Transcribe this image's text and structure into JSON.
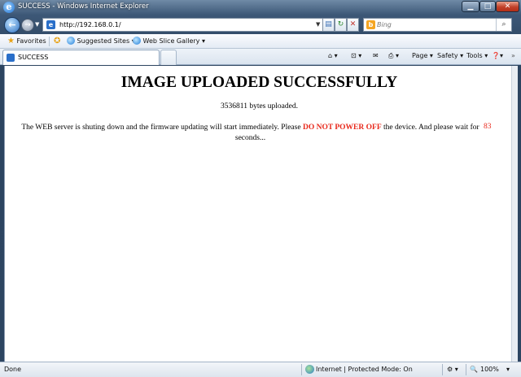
{
  "window": {
    "title": "SUCCESS - Windows Internet Explorer",
    "icon": "ie-logo-icon"
  },
  "nav": {
    "url": "http://192.168.0.1/",
    "search_placeholder": "Bing"
  },
  "favorites": {
    "label": "Favorites",
    "items": [
      {
        "label": "Suggested Sites ▾"
      },
      {
        "label": "Web Slice Gallery ▾"
      }
    ]
  },
  "tabs": [
    {
      "label": "SUCCESS"
    }
  ],
  "commandbar": {
    "page": "Page ▾",
    "safety": "Safety ▾",
    "tools": "Tools ▾",
    "help": "❓▾"
  },
  "content": {
    "heading": "IMAGE UPLOADED SUCCESSFULLY",
    "bytes_uploaded": "3536811 bytes uploaded.",
    "message_before": "The WEB server is shuting down and the firmware updating will start immediately. Please ",
    "warning": "DO NOT POWER OFF",
    "message_after": " the device. And please wait for seconds...",
    "countdown": "83"
  },
  "status": {
    "text": "Done",
    "zone": "Internet | Protected Mode: On",
    "zoom": "100%"
  },
  "colors": {
    "warning": "#e8281b",
    "frame": "#2c4460"
  }
}
